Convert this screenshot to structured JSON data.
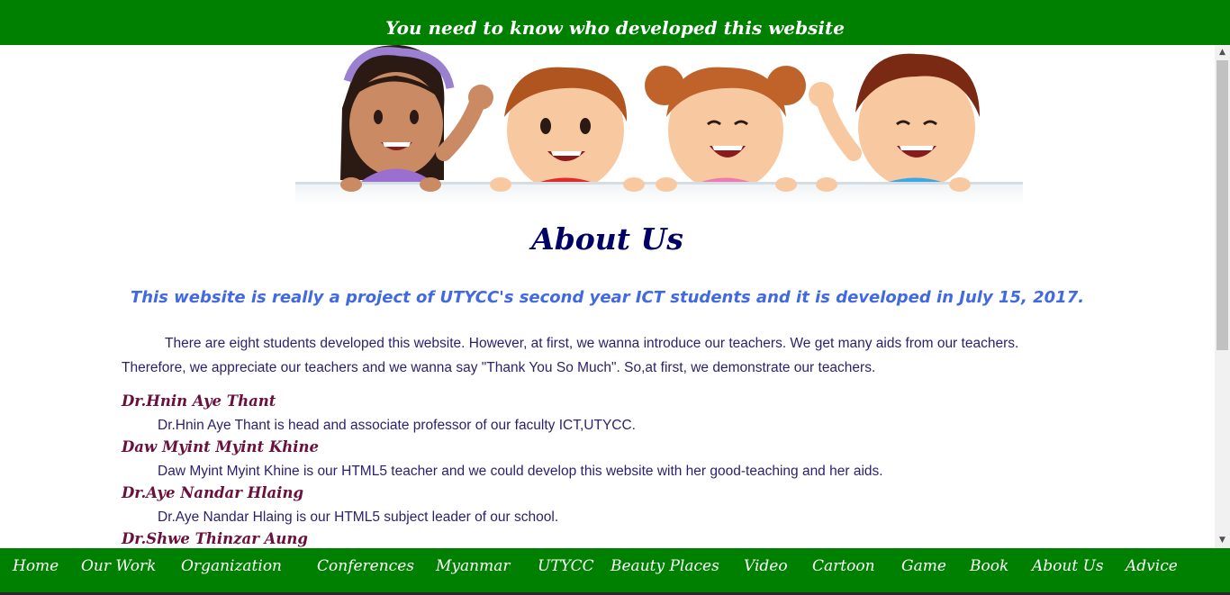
{
  "topbar": {
    "text": "You need to know who developed this website"
  },
  "main": {
    "title": "About Us",
    "subtitle": "This website is really a project of UTYCC's second year ICT students and it is developed in July 15, 2017.",
    "intro": "There are eight students developed this website. However, at first, we wanna introduce our teachers. We get many aids from our teachers. Therefore, we appreciate our teachers and we wanna say \"Thank You So Much\". So,at first, we demonstrate our teachers.",
    "teachers": [
      {
        "name": "Dr.Hnin Aye Thant",
        "description": "Dr.Hnin Aye Thant is head and associate professor of our faculty ICT,UTYCC."
      },
      {
        "name": "Daw Myint Myint Khine",
        "description": "Daw Myint Myint Khine is our HTML5 teacher and we could develop this website with her good-teaching and her aids."
      },
      {
        "name": "Dr.Aye Nandar Hlaing",
        "description": "Dr.Aye Nandar Hlaing is our HTML5 subject leader of our school."
      },
      {
        "name": "Dr.Shwe Thinzar Aung",
        "description": ""
      }
    ]
  },
  "nav": {
    "items": [
      "Home",
      "Our Work",
      "Organization",
      "Conferences",
      "Myanmar",
      "UTYCC",
      "Beauty Places",
      "Video",
      "Cartoon",
      "Game",
      "Book",
      "About Us",
      "Advice"
    ]
  },
  "colors": {
    "bar_green": "#008000",
    "heading": "#000066",
    "subheading": "#4169e1",
    "teacher_name": "#6b0f3c",
    "body_text": "#2c1f6b"
  },
  "icons": {
    "scroll_up": "triangle-up-icon",
    "scroll_down": "triangle-down-icon"
  }
}
